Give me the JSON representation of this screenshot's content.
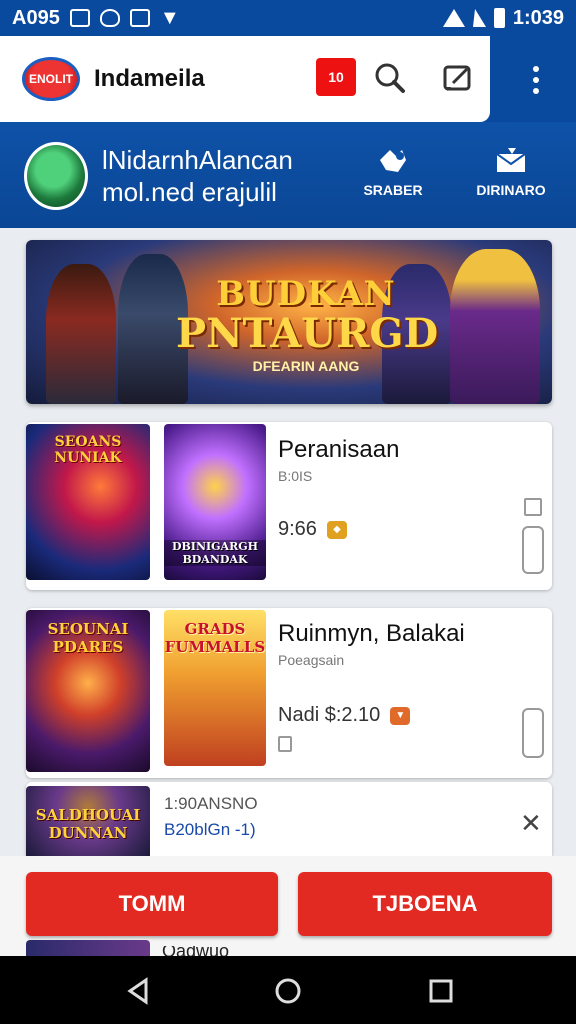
{
  "status_bar": {
    "left_text": "A095",
    "time": "1:039"
  },
  "app_bar": {
    "logo_text": "ENOLIT",
    "title": "Indameila",
    "notification_count": "10"
  },
  "header_band": {
    "title_line1": "lNidarnhAlancan",
    "title_line2": "mol.ned erajulil",
    "actions": [
      {
        "label": "SRABER",
        "icon": "puzzle-icon"
      },
      {
        "label": "DIRINARO",
        "icon": "mail-icon"
      }
    ]
  },
  "banner": {
    "line1": "BUDKAN",
    "line2": "PNTAURGD",
    "line3": "DFEARIN AANG"
  },
  "cards": [
    {
      "title": "Peranisaan",
      "subtitle": "B:0IS",
      "price": "9:66",
      "thumb1_label": "SEOANS NUNIAK",
      "thumb2_label": "DBINIGARGH BDANDAK",
      "price_color": "#e0a020"
    },
    {
      "title": "Ruinmyn, Balakai",
      "subtitle": "Poeagsain",
      "price": "Nadi $:2.10",
      "thumb1_label": "SEOUNAI PDARES",
      "thumb2_label": "GRADS FUMMALLS",
      "price_color": "#e06a2a"
    },
    {
      "line1": "1:90ANSNO",
      "line2": "B20blGn -1)",
      "thumb_label": "SALDHOUAI DUNNAN"
    }
  ],
  "buttons": {
    "primary": "TOMM",
    "secondary": "TJBOENA"
  },
  "peek_text": "Oadwuo"
}
